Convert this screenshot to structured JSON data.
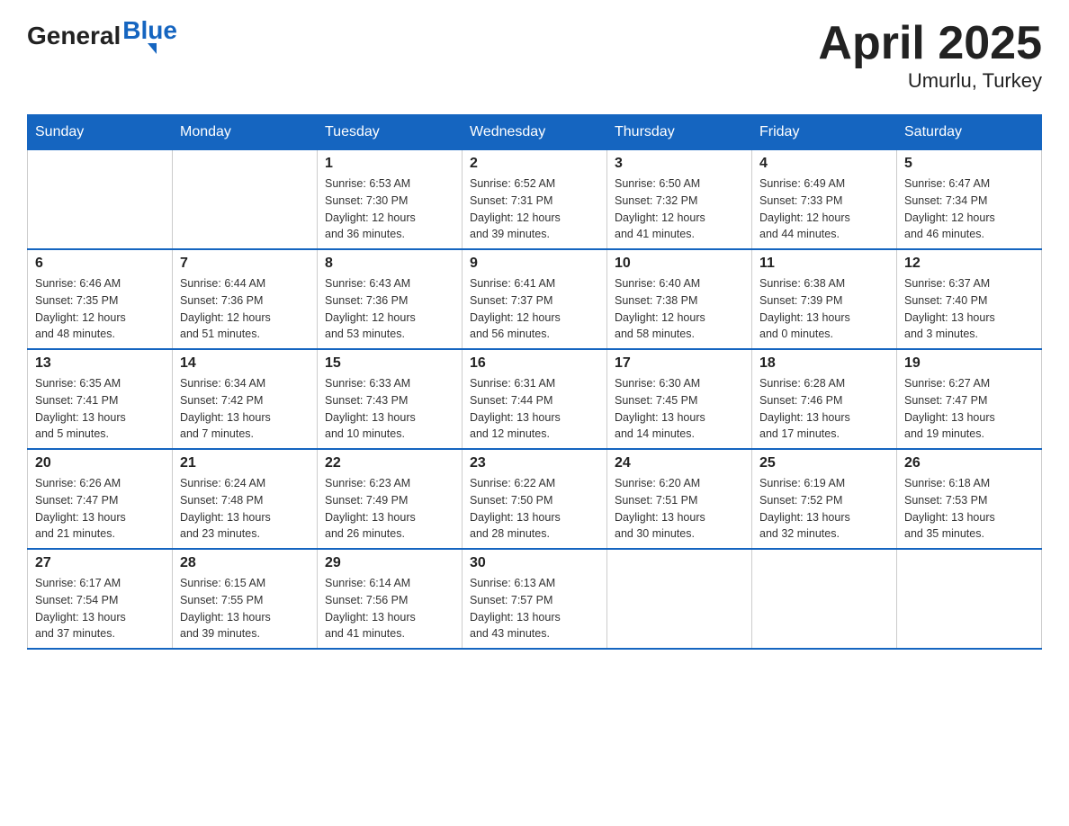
{
  "header": {
    "logo_general": "General",
    "logo_blue": "Blue",
    "title": "April 2025",
    "subtitle": "Umurlu, Turkey"
  },
  "days_of_week": [
    "Sunday",
    "Monday",
    "Tuesday",
    "Wednesday",
    "Thursday",
    "Friday",
    "Saturday"
  ],
  "weeks": [
    [
      {
        "day": "",
        "info": ""
      },
      {
        "day": "",
        "info": ""
      },
      {
        "day": "1",
        "info": "Sunrise: 6:53 AM\nSunset: 7:30 PM\nDaylight: 12 hours\nand 36 minutes."
      },
      {
        "day": "2",
        "info": "Sunrise: 6:52 AM\nSunset: 7:31 PM\nDaylight: 12 hours\nand 39 minutes."
      },
      {
        "day": "3",
        "info": "Sunrise: 6:50 AM\nSunset: 7:32 PM\nDaylight: 12 hours\nand 41 minutes."
      },
      {
        "day": "4",
        "info": "Sunrise: 6:49 AM\nSunset: 7:33 PM\nDaylight: 12 hours\nand 44 minutes."
      },
      {
        "day": "5",
        "info": "Sunrise: 6:47 AM\nSunset: 7:34 PM\nDaylight: 12 hours\nand 46 minutes."
      }
    ],
    [
      {
        "day": "6",
        "info": "Sunrise: 6:46 AM\nSunset: 7:35 PM\nDaylight: 12 hours\nand 48 minutes."
      },
      {
        "day": "7",
        "info": "Sunrise: 6:44 AM\nSunset: 7:36 PM\nDaylight: 12 hours\nand 51 minutes."
      },
      {
        "day": "8",
        "info": "Sunrise: 6:43 AM\nSunset: 7:36 PM\nDaylight: 12 hours\nand 53 minutes."
      },
      {
        "day": "9",
        "info": "Sunrise: 6:41 AM\nSunset: 7:37 PM\nDaylight: 12 hours\nand 56 minutes."
      },
      {
        "day": "10",
        "info": "Sunrise: 6:40 AM\nSunset: 7:38 PM\nDaylight: 12 hours\nand 58 minutes."
      },
      {
        "day": "11",
        "info": "Sunrise: 6:38 AM\nSunset: 7:39 PM\nDaylight: 13 hours\nand 0 minutes."
      },
      {
        "day": "12",
        "info": "Sunrise: 6:37 AM\nSunset: 7:40 PM\nDaylight: 13 hours\nand 3 minutes."
      }
    ],
    [
      {
        "day": "13",
        "info": "Sunrise: 6:35 AM\nSunset: 7:41 PM\nDaylight: 13 hours\nand 5 minutes."
      },
      {
        "day": "14",
        "info": "Sunrise: 6:34 AM\nSunset: 7:42 PM\nDaylight: 13 hours\nand 7 minutes."
      },
      {
        "day": "15",
        "info": "Sunrise: 6:33 AM\nSunset: 7:43 PM\nDaylight: 13 hours\nand 10 minutes."
      },
      {
        "day": "16",
        "info": "Sunrise: 6:31 AM\nSunset: 7:44 PM\nDaylight: 13 hours\nand 12 minutes."
      },
      {
        "day": "17",
        "info": "Sunrise: 6:30 AM\nSunset: 7:45 PM\nDaylight: 13 hours\nand 14 minutes."
      },
      {
        "day": "18",
        "info": "Sunrise: 6:28 AM\nSunset: 7:46 PM\nDaylight: 13 hours\nand 17 minutes."
      },
      {
        "day": "19",
        "info": "Sunrise: 6:27 AM\nSunset: 7:47 PM\nDaylight: 13 hours\nand 19 minutes."
      }
    ],
    [
      {
        "day": "20",
        "info": "Sunrise: 6:26 AM\nSunset: 7:47 PM\nDaylight: 13 hours\nand 21 minutes."
      },
      {
        "day": "21",
        "info": "Sunrise: 6:24 AM\nSunset: 7:48 PM\nDaylight: 13 hours\nand 23 minutes."
      },
      {
        "day": "22",
        "info": "Sunrise: 6:23 AM\nSunset: 7:49 PM\nDaylight: 13 hours\nand 26 minutes."
      },
      {
        "day": "23",
        "info": "Sunrise: 6:22 AM\nSunset: 7:50 PM\nDaylight: 13 hours\nand 28 minutes."
      },
      {
        "day": "24",
        "info": "Sunrise: 6:20 AM\nSunset: 7:51 PM\nDaylight: 13 hours\nand 30 minutes."
      },
      {
        "day": "25",
        "info": "Sunrise: 6:19 AM\nSunset: 7:52 PM\nDaylight: 13 hours\nand 32 minutes."
      },
      {
        "day": "26",
        "info": "Sunrise: 6:18 AM\nSunset: 7:53 PM\nDaylight: 13 hours\nand 35 minutes."
      }
    ],
    [
      {
        "day": "27",
        "info": "Sunrise: 6:17 AM\nSunset: 7:54 PM\nDaylight: 13 hours\nand 37 minutes."
      },
      {
        "day": "28",
        "info": "Sunrise: 6:15 AM\nSunset: 7:55 PM\nDaylight: 13 hours\nand 39 minutes."
      },
      {
        "day": "29",
        "info": "Sunrise: 6:14 AM\nSunset: 7:56 PM\nDaylight: 13 hours\nand 41 minutes."
      },
      {
        "day": "30",
        "info": "Sunrise: 6:13 AM\nSunset: 7:57 PM\nDaylight: 13 hours\nand 43 minutes."
      },
      {
        "day": "",
        "info": ""
      },
      {
        "day": "",
        "info": ""
      },
      {
        "day": "",
        "info": ""
      }
    ]
  ]
}
